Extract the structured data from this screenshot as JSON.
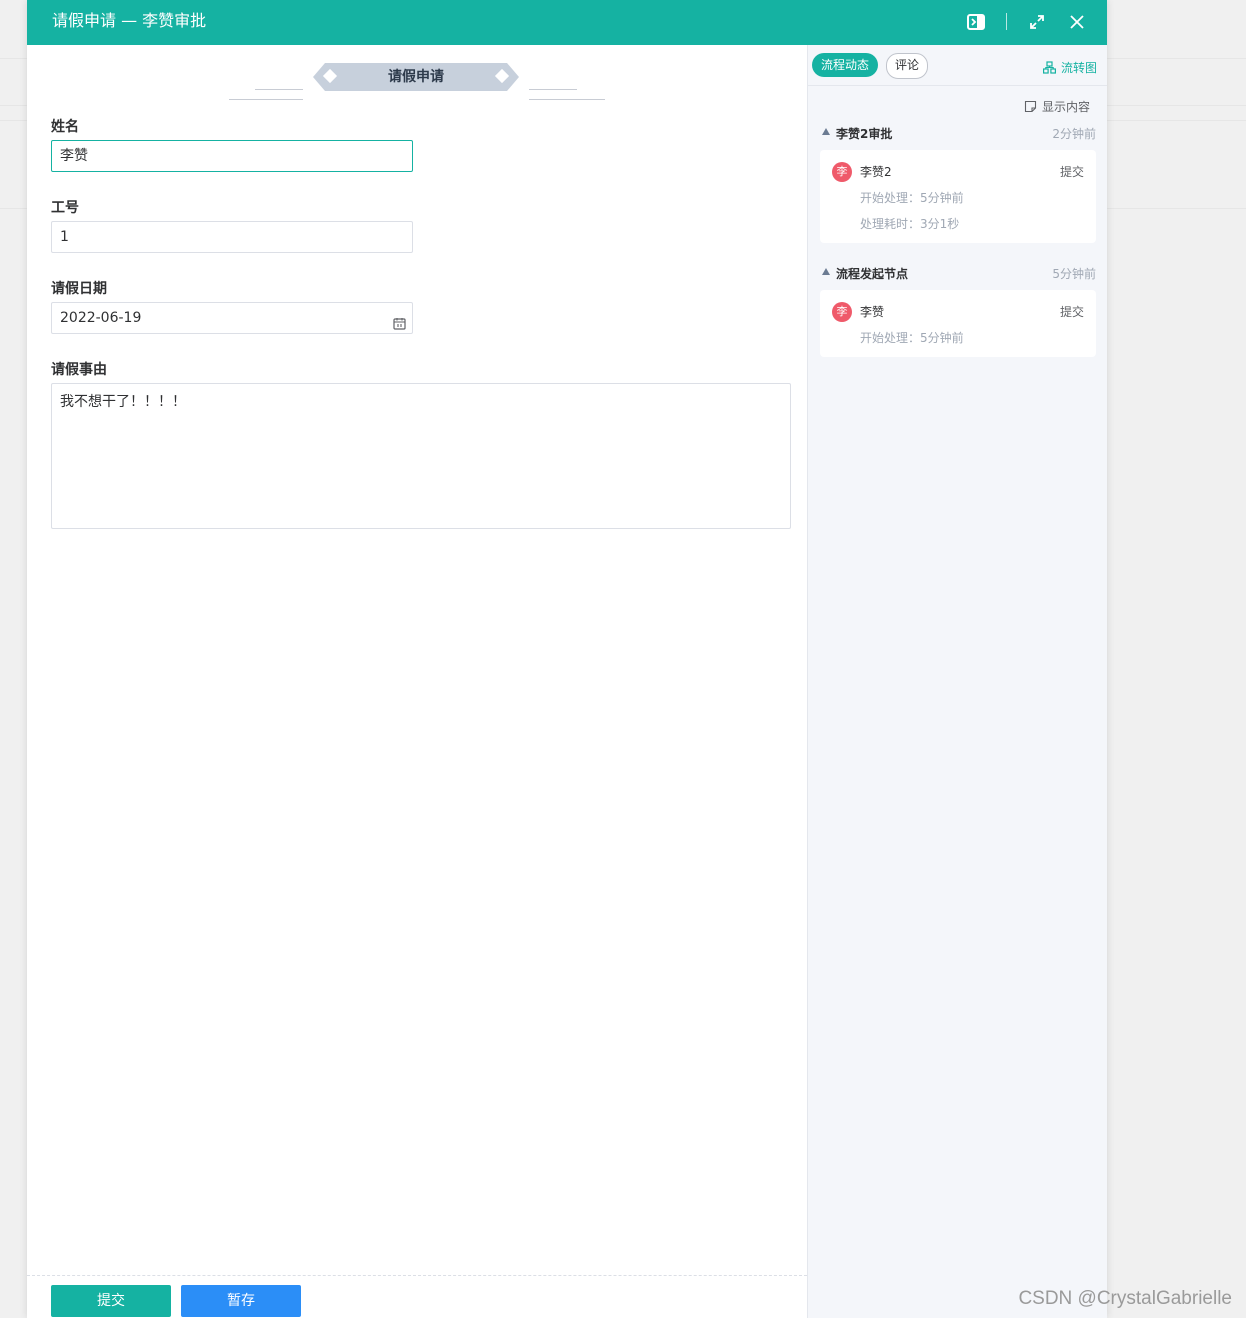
{
  "dialog": {
    "title": "请假申请 — 李赞审批"
  },
  "form": {
    "section_title": "请假申请",
    "fields": {
      "name": {
        "label": "姓名",
        "value": "李赞"
      },
      "employee_id": {
        "label": "工号",
        "value": "1"
      },
      "leave_date": {
        "label": "请假日期",
        "value": "2022-06-19"
      },
      "reason": {
        "label": "请假事由",
        "value": "我不想干了！！！！"
      }
    },
    "buttons": {
      "submit": "提交",
      "save_draft": "暂存"
    }
  },
  "side": {
    "tabs": [
      {
        "label": "流程动态",
        "active": true
      },
      {
        "label": "评论",
        "active": false
      }
    ],
    "flowchart_link": "流转图",
    "show_content": "显示内容",
    "nodes": [
      {
        "name": "李赞2审批",
        "time": "2分钟前",
        "entries": [
          {
            "avatar": "李",
            "user": "李赞2",
            "action": "提交",
            "meta": [
              "开始处理：5分钟前",
              "处理耗时：3分1秒"
            ]
          }
        ]
      },
      {
        "name": "流程发起节点",
        "time": "5分钟前",
        "entries": [
          {
            "avatar": "李",
            "user": "李赞",
            "action": "提交",
            "meta": [
              "开始处理：5分钟前"
            ]
          }
        ]
      }
    ]
  },
  "watermark": "CSDN @CrystalGabrielle",
  "colors": {
    "accent": "#15b2a2",
    "save_button": "#2b8ef7",
    "avatar": "#ef5a6a"
  }
}
